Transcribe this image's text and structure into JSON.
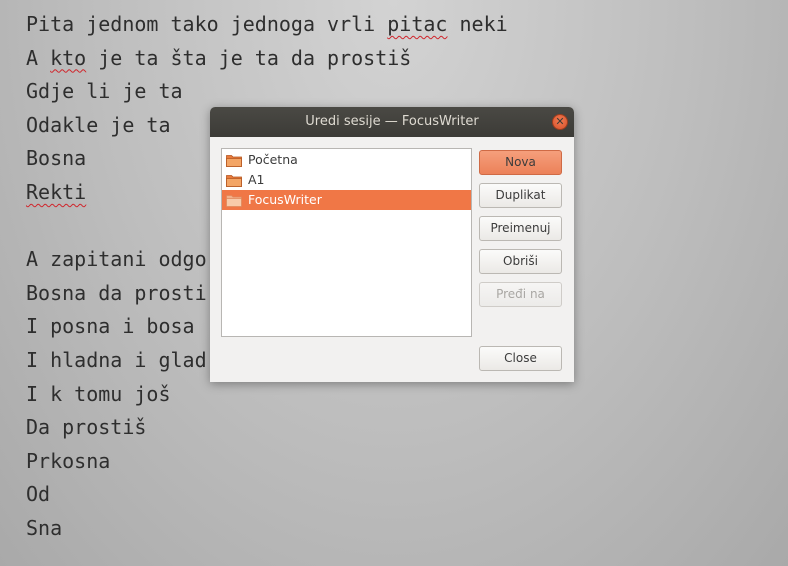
{
  "editor": {
    "lines": [
      "Pita jednom tako jednoga vrli pitac neki",
      "A kto je ta šta je ta da prostiš",
      "Gdje li je ta",
      "Odakle je ta",
      "Bosna",
      "Rekti",
      "",
      "A zapitani odgo",
      "Bosna da prosti",
      "I posna i bosa",
      "I hladna i glad",
      "I k tomu još",
      "Da prostiš",
      "Prkosna",
      "Od",
      "Sna"
    ],
    "line1_a": "Pita jednom tako jednoga vrli ",
    "line1_miss": "pitac",
    "line1_b": " neki",
    "line2_a": "A ",
    "line2_miss": "kto",
    "line2_b": " je ta šta je ta da prostiš",
    "line6_miss": "Rekti"
  },
  "dialog": {
    "title": "Uredi sesije — FocusWriter",
    "close_glyph": "✕",
    "sessions": [
      {
        "label": "Početna",
        "selected": false
      },
      {
        "label": "A1",
        "selected": false
      },
      {
        "label": "FocusWriter",
        "selected": true
      }
    ],
    "buttons": {
      "new": "Nova",
      "duplicate": "Duplikat",
      "rename": "Preimenuj",
      "delete": "Obriši",
      "switch_to": "Pređi na",
      "close": "Close"
    }
  },
  "colors": {
    "accent": "#f07746",
    "titlebar": "#3c3b37",
    "spell_underline": "#d0242b"
  },
  "icons": {
    "folder": "folder-icon",
    "close": "close-icon"
  }
}
